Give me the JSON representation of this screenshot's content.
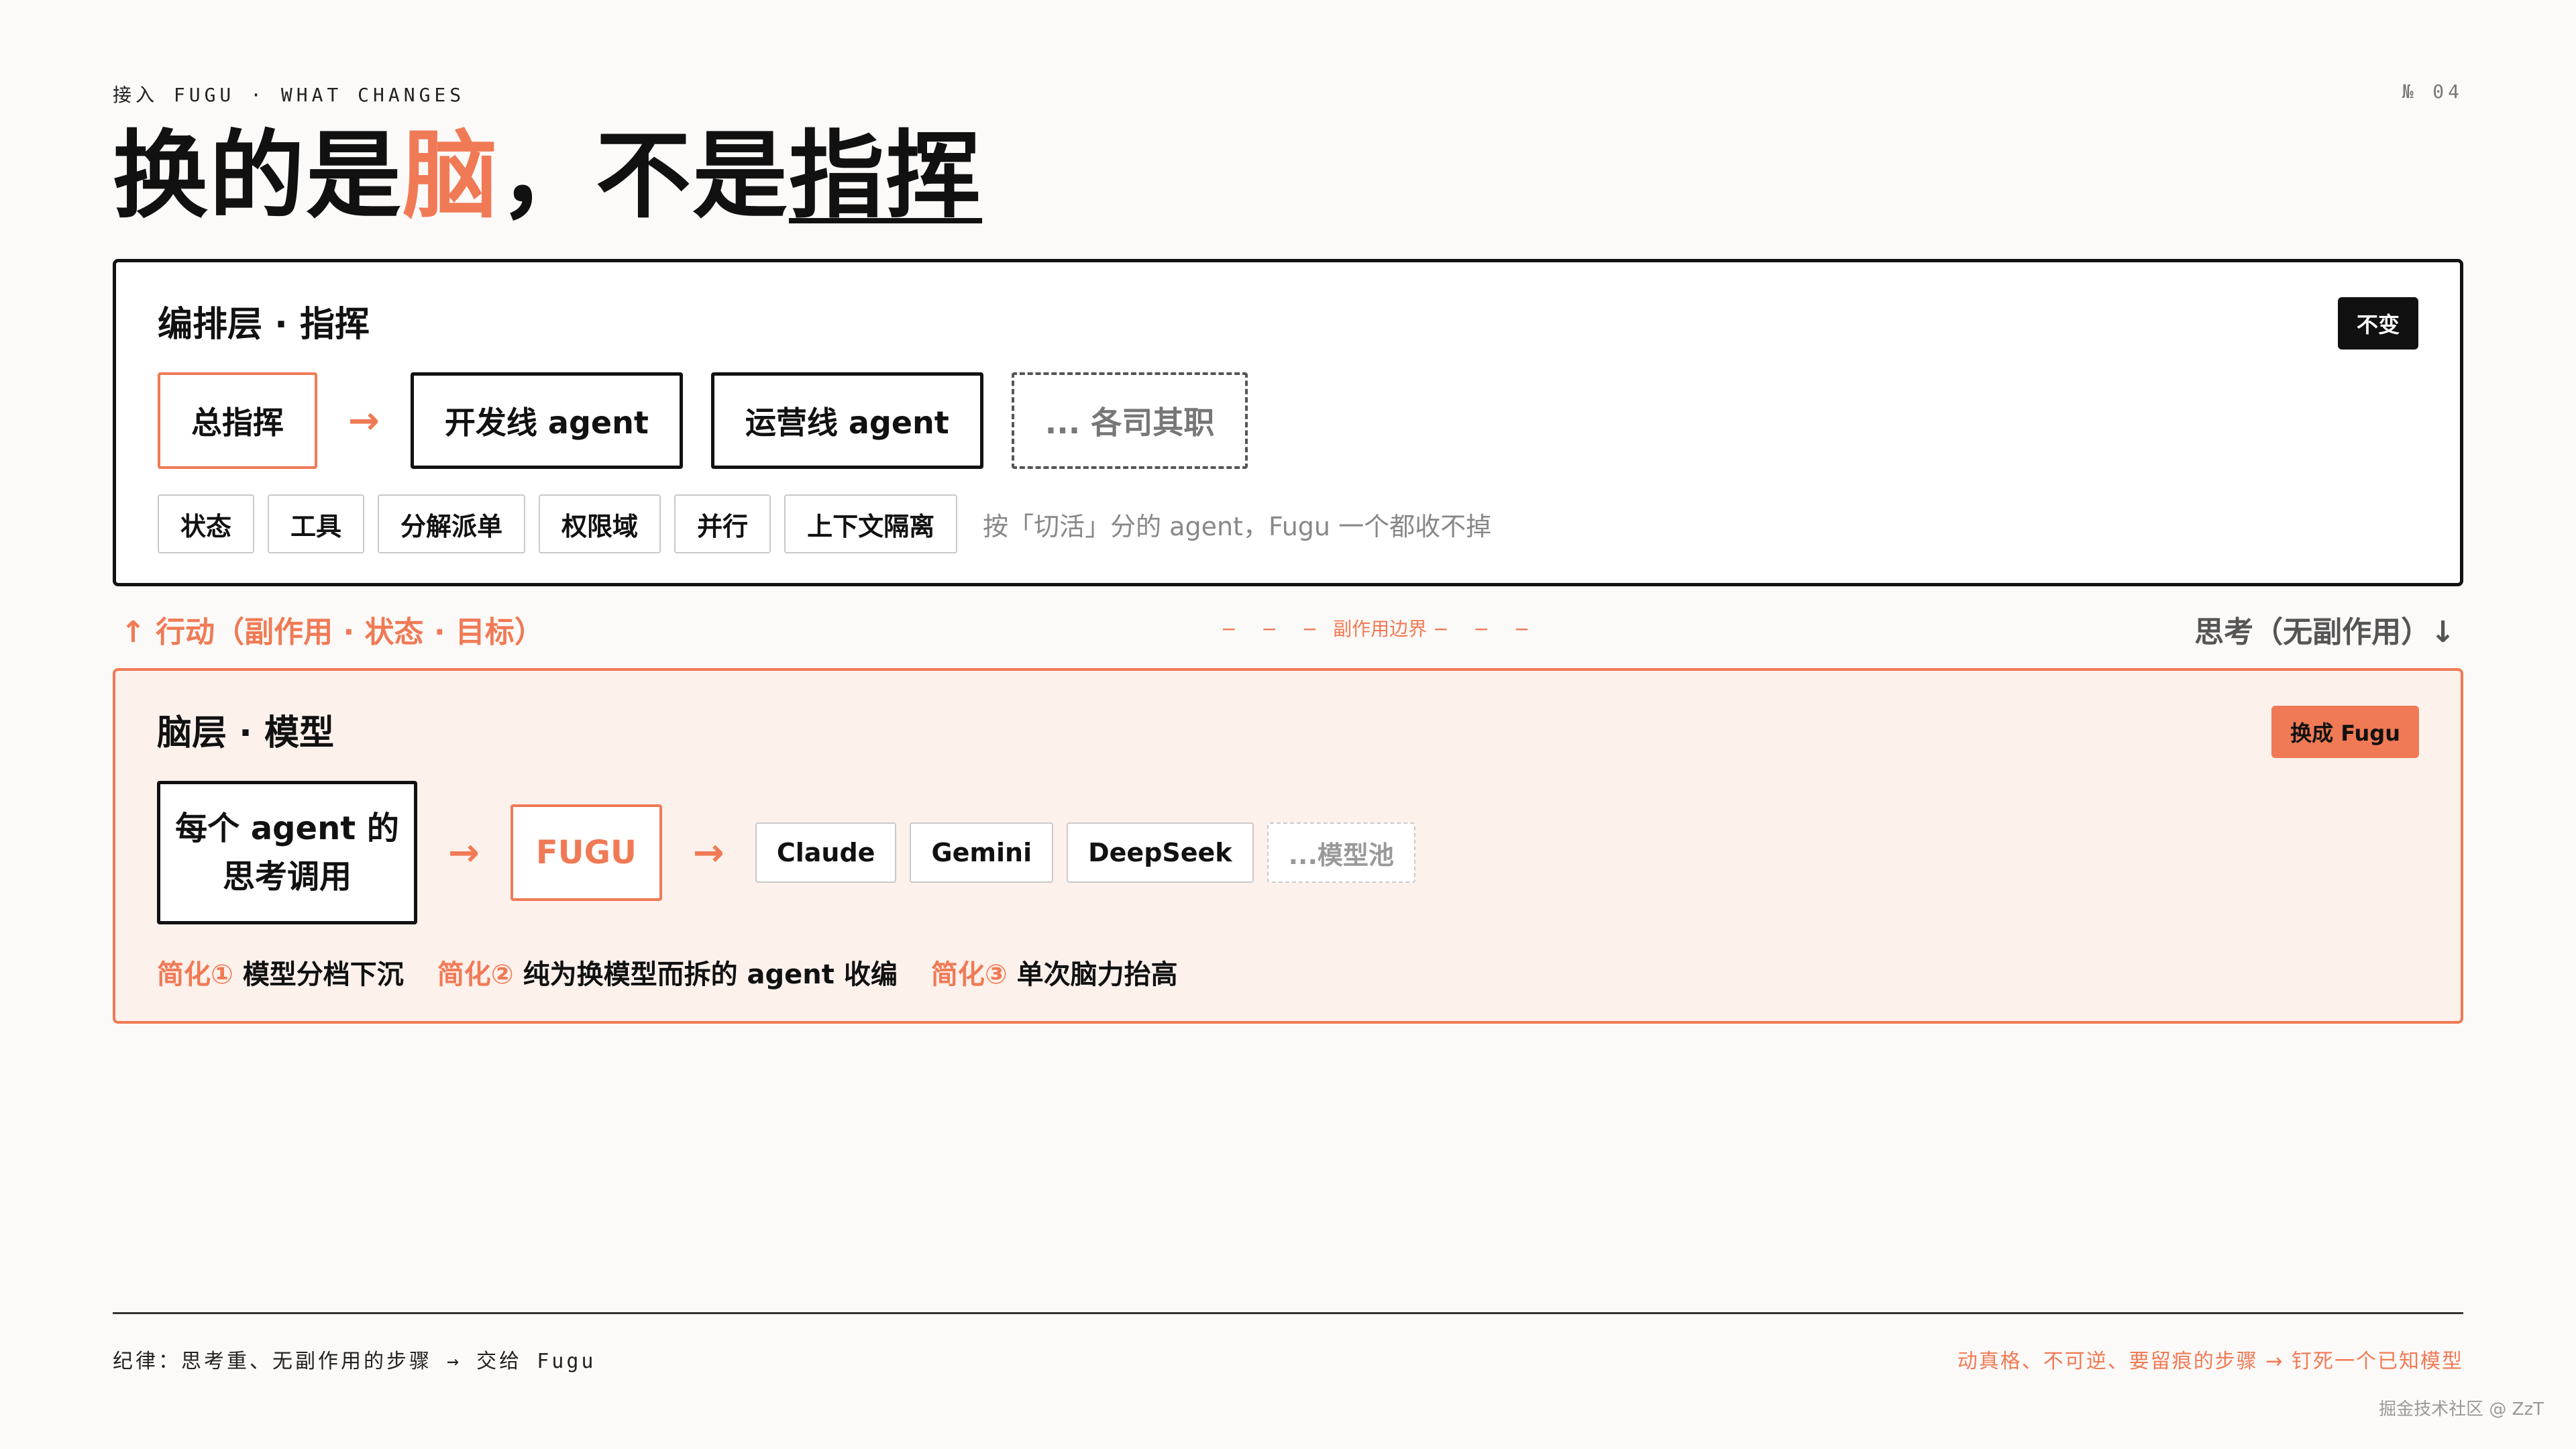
{
  "header": {
    "kicker": "接入 FUGU · WHAT CHANGES",
    "page_no": "№ 04",
    "title": {
      "part1": "换的是",
      "accent": "脑",
      "part2": "，不是",
      "underline": "指挥"
    }
  },
  "orchestration": {
    "title": "编排层 · 指挥",
    "tag": "不变",
    "nodes": [
      "总指挥",
      "开发线 agent",
      "运营线 agent",
      "... 各司其职"
    ],
    "arrow": "→",
    "chips": [
      "状态",
      "工具",
      "分解派单",
      "权限域",
      "并行",
      "上下文隔离"
    ],
    "note": "按「切活」分的 agent，Fugu 一个都收不掉"
  },
  "boundary": {
    "action": "↑ 行动（副作用 · 状态 · 目标）",
    "middle": "副作用边界",
    "middle_dashes": "− − −",
    "thinking": "思考（无副作用）↓"
  },
  "brain": {
    "title": "脑层 · 模型",
    "tag": "换成 Fugu",
    "caller_line1": "每个 agent 的",
    "caller_line2": "思考调用",
    "fugu": "FUGU",
    "arrow": "→",
    "models": [
      "Claude",
      "Gemini",
      "DeepSeek",
      "...模型池"
    ],
    "simplifications": [
      {
        "label": "简化①",
        "text": "模型分档下沉"
      },
      {
        "label": "简化②",
        "text": "纯为换模型而拆的 agent 收编"
      },
      {
        "label": "简化③",
        "text": "单次脑力抬高"
      }
    ]
  },
  "footer": {
    "left": "纪律：思考重、无副作用的步骤 → 交给 Fugu",
    "right": "动真格、不可逆、要留痕的步骤 → 钉死一个已知模型",
    "watermark": "掘金技术社区 @ ZzT"
  },
  "colors": {
    "accent": "#f07a55",
    "ink": "#111111",
    "background": "#fcfaf8",
    "brain_bg": "#fdf1ec"
  }
}
